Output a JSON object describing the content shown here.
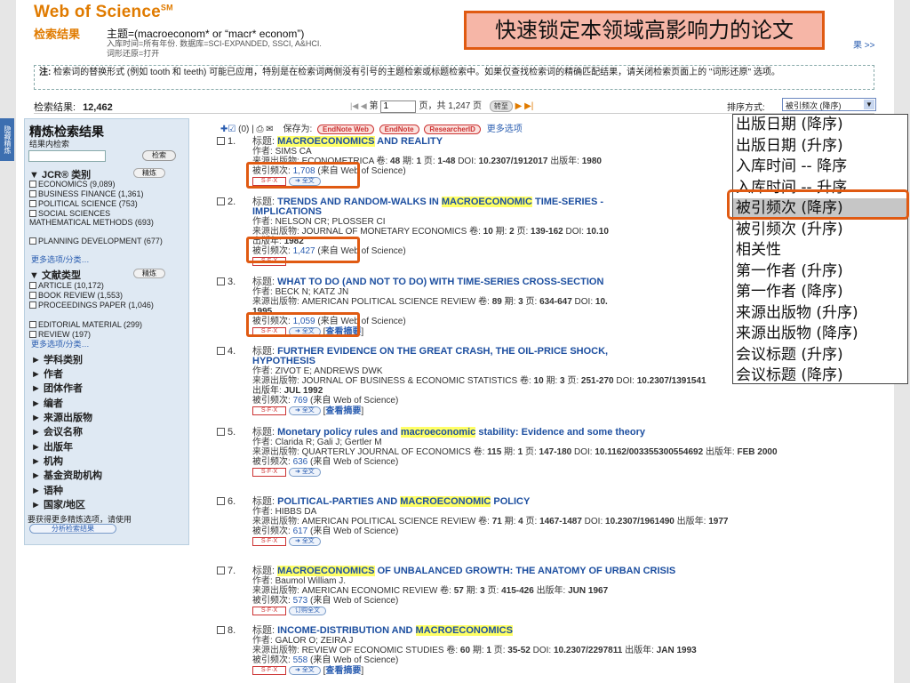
{
  "header": {
    "logo": "Web of Science",
    "logo_sup": "SM",
    "query_label": "检索结果",
    "query": "主题=(macroeconom* or “macr* econom”)",
    "query_sub1": "入库时间=所有年份. 数据库=SCI-EXPANDED, SSCI, A&HCI.",
    "query_sub2": "词形还原=打开",
    "callout": "快速锁定本领域高影响力的论文",
    "right_link": "果 >>"
  },
  "note": {
    "label": "注:",
    "text": "检索词的替换形式 (例如 tooth 和 teeth) 可能已应用，特别是在检索词两侧没有引号的主题检索或标题检索中。如果仅查找检索词的精确匹配结果，请关闭检索页面上的 \"词形还原\" 选项。"
  },
  "results_bar": {
    "label": "检索结果:",
    "count": "12,462",
    "page_prefix": "第",
    "page_value": "1",
    "page_suffix": "页，共 1,247 页",
    "go_label": "转至",
    "sort_label": "排序方式:",
    "sort_value": "被引频次 (降序)"
  },
  "sidebar": {
    "title": "精炼检索结果",
    "sub": "结果内检索",
    "search_btn": "检索",
    "refine_btn": "精炼",
    "jcr_title": "JCR® 类别",
    "jcr_items": [
      "ECONOMICS (9,089)",
      "BUSINESS FINANCE (1,361)",
      "POLITICAL SCIENCE (753)",
      "SOCIAL SCIENCES MATHEMATICAL METHODS (693)",
      "PLANNING DEVELOPMENT (677)"
    ],
    "more": "更多选项/分类…",
    "doctype_title": "文献类型",
    "doctype_items": [
      "ARTICLE (10,172)",
      "BOOK REVIEW (1,553)",
      "PROCEEDINGS PAPER (1,046)",
      "EDITORIAL MATERIAL (299)",
      "REVIEW (197)"
    ],
    "collapsed": [
      "学科类别",
      "作者",
      "团体作者",
      "编者",
      "来源出版物",
      "会议名称",
      "出版年",
      "机构",
      "基金资助机构",
      "语种",
      "国家/地区"
    ],
    "foot": "要获得更多精炼选项，请使用",
    "analysis_btn": "分析检索结果",
    "side_tab": "隐藏精炼"
  },
  "toolbar": {
    "count": "(0)",
    "save_to": "保存为:",
    "endnote_web": "EndNote Web",
    "endnote": "EndNote",
    "researcherid": "ResearcherID",
    "more": "更多选项"
  },
  "labels": {
    "title": "标题:",
    "author": "作者:",
    "source": "来源出版物:",
    "vol": "卷",
    "issue": "期",
    "pages": "页:",
    "doi": "DOI:",
    "pubdate": "出版年:",
    "cited": "被引频次:",
    "cited_from": "(来自 Web of Science)",
    "sfx": "S·F·X",
    "fulltext": "全文",
    "order": "订购全文",
    "abstract": "查看摘要"
  },
  "records": [
    {
      "n": "1.",
      "title_pre": "",
      "title_hl": "MACROECONOMICS",
      "title_post": " AND REALITY",
      "author": "SIMS CA",
      "source": "ECONOMETRICA",
      "vol": "48",
      "issue": "1",
      "pages": "1-48",
      "doi": "10.2307/1912017",
      "date": "1980",
      "cited": "1,708"
    },
    {
      "n": "2.",
      "title_pre": "TRENDS AND RANDOM-WALKS IN ",
      "title_hl": "MACROECONOMIC",
      "title_post": " TIME-SERIES - ",
      "title_line2": "IMPLICATIONS",
      "author": "NELSON CR; PLOSSER CI",
      "source": "JOURNAL OF MONETARY ECONOMICS",
      "vol": "10",
      "issue": "2",
      "pages": "139-162",
      "doi": "10.10",
      "date": "1982",
      "cited": "1,427"
    },
    {
      "n": "3.",
      "title_pre": "WHAT TO DO (AND NOT TO DO) WITH TIME-SERIES CROSS-SECTION",
      "title_hl": "",
      "title_post": "",
      "author": "BECK N; KATZ JN",
      "source": "AMERICAN POLITICAL SCIENCE REVIEW",
      "vol": "89",
      "issue": "3",
      "pages": "634-647",
      "doi": "10.",
      "date": "1995",
      "cited": "1,059"
    },
    {
      "n": "4.",
      "title_pre": "FURTHER EVIDENCE ON THE GREAT CRASH, THE OIL-PRICE SHOCK,",
      "title_hl": "",
      "title_post": "",
      "title_line2": "HYPOTHESIS",
      "author": "ZIVOT E; ANDREWS DWK",
      "source": "JOURNAL OF BUSINESS & ECONOMIC STATISTICS",
      "vol": "10",
      "issue": "3",
      "pages": "251-270",
      "doi": "10.2307/1391541",
      "date": "JUL 1992",
      "cited": "769"
    },
    {
      "n": "5.",
      "title_pre": "Monetary policy rules and ",
      "title_hl": "macroeconomic",
      "title_post": " stability: Evidence and some theory",
      "author": "Clarida R; Gali J; Gertler M",
      "source": "QUARTERLY JOURNAL OF ECONOMICS",
      "vol": "115",
      "issue": "1",
      "pages": "147-180",
      "doi": "10.1162/003355300554692",
      "date": "FEB 2000",
      "cited": "636"
    },
    {
      "n": "6.",
      "title_pre": "POLITICAL-PARTIES AND ",
      "title_hl": "MACROECONOMIC",
      "title_post": " POLICY",
      "author": "HIBBS DA",
      "source": "AMERICAN POLITICAL SCIENCE REVIEW",
      "vol": "71",
      "issue": "4",
      "pages": "1467-1487",
      "doi": "10.2307/1961490",
      "date": "1977",
      "cited": "617"
    },
    {
      "n": "7.",
      "title_pre": "",
      "title_hl": "MACROECONOMICS",
      "title_post": " OF UNBALANCED GROWTH: THE ANATOMY OF URBAN CRISIS",
      "author": "Baumol William J.",
      "source": "AMERICAN ECONOMIC REVIEW",
      "vol": "57",
      "issue": "3",
      "pages": "415-426",
      "doi": "",
      "date": "JUN 1967",
      "cited": "573"
    },
    {
      "n": "8.",
      "title_pre": "INCOME-DISTRIBUTION AND ",
      "title_hl": "MACROECONOMICS",
      "title_post": "",
      "author": "GALOR O; ZEIRA J",
      "source": "REVIEW OF ECONOMIC STUDIES",
      "vol": "60",
      "issue": "1",
      "pages": "35-52",
      "doi": "10.2307/2297811",
      "date": "JAN 1993",
      "cited": "558"
    }
  ],
  "sort_popup": {
    "options": [
      "出版日期 (降序)",
      "出版日期 (升序)",
      "入库时间 -- 降序",
      "入库时间 -- 升序",
      "被引频次 (降序)",
      "被引频次 (升序)",
      "相关性",
      "第一作者 (升序)",
      "第一作者 (降序)",
      "来源出版物 (升序)",
      "来源出版物 (降序)",
      "会议标题 (升序)",
      "会议标题 (降序)"
    ],
    "selected_index": 4
  },
  "colors": {
    "accent_orange": "#e07b00",
    "highlight_box": "#e05a12",
    "link_blue": "#2a5db0",
    "sidebar_bg": "#dfe9f3"
  }
}
